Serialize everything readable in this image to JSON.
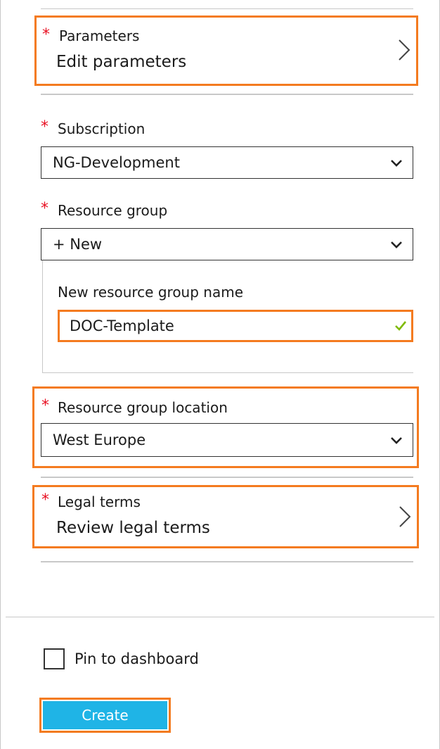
{
  "parameters": {
    "label": "Parameters",
    "value": "Edit parameters",
    "required_marker": "*"
  },
  "subscription": {
    "label": "Subscription",
    "selected": "NG-Development",
    "required_marker": "*"
  },
  "resource_group": {
    "label": "Resource group",
    "selected": "+ New",
    "required_marker": "*",
    "new_name_label": "New resource group name",
    "new_name_value": "DOC-Template"
  },
  "location": {
    "label": "Resource group location",
    "selected": "West Europe",
    "required_marker": "*"
  },
  "legal_terms": {
    "label": "Legal terms",
    "value": "Review legal terms",
    "required_marker": "*"
  },
  "footer": {
    "pin_label": "Pin to dashboard",
    "pin_checked": false,
    "create_label": "Create"
  },
  "colors": {
    "highlight": "#f47b20",
    "required": "#e81123",
    "primary_button": "#1fb4e6",
    "valid_check": "#7fba00"
  },
  "icons": {
    "chevron_right": "chevron-right-icon",
    "chevron_down": "chevron-down-icon",
    "valid": "checkmark-icon"
  }
}
